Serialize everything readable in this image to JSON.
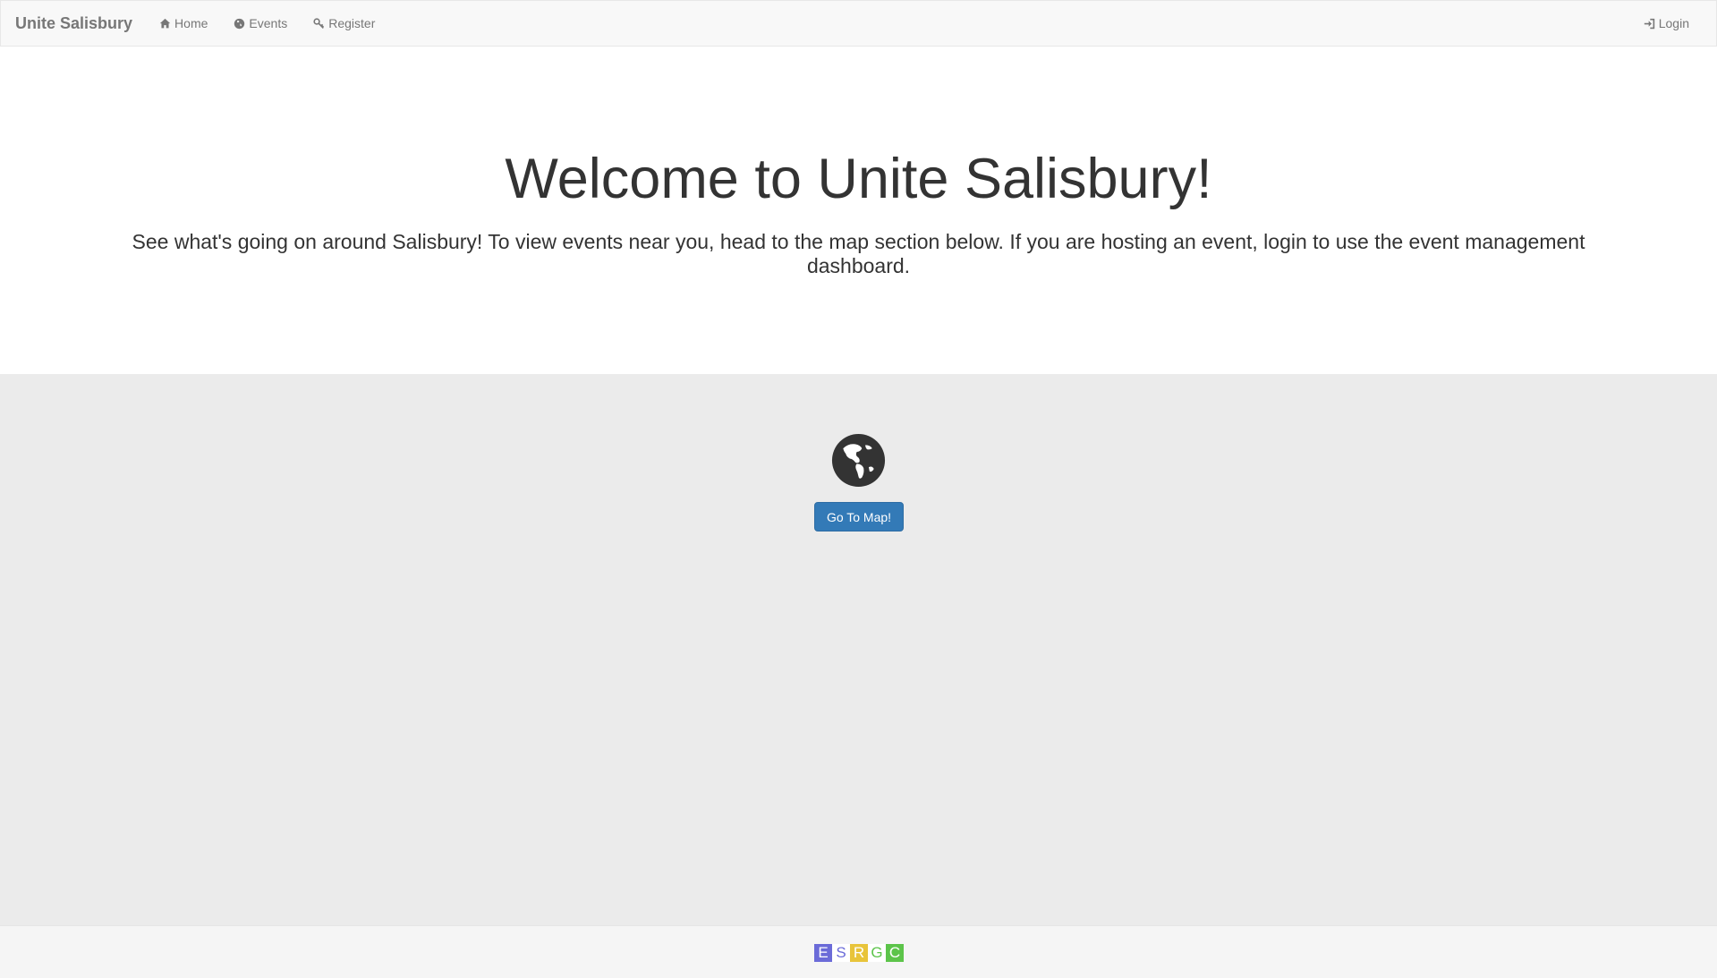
{
  "navbar": {
    "brand": "Unite Salisbury",
    "links": [
      {
        "label": "Home",
        "icon": "home-icon"
      },
      {
        "label": "Events",
        "icon": "globe-icon"
      },
      {
        "label": "Register",
        "icon": "key-icon"
      }
    ],
    "login": {
      "label": "Login",
      "icon": "login-icon"
    }
  },
  "hero": {
    "title": "Welcome to Unite Salisbury!",
    "subtitle": "See what's going on around Salisbury! To view events near you, head to the map section below. If you are hosting an event, login to use the event management dashboard."
  },
  "map_section": {
    "icon": "globe-icon",
    "button_label": "Go To Map!"
  },
  "footer": {
    "logo_letters": [
      {
        "letter": "E",
        "bg": "#6b6bd8",
        "fg": "#ffffff"
      },
      {
        "letter": "S",
        "bg": "#ffffff",
        "fg": "#6b6bd8"
      },
      {
        "letter": "R",
        "bg": "#e8c43a",
        "fg": "#ffffff"
      },
      {
        "letter": "G",
        "bg": "#ffffff",
        "fg": "#5cc44a"
      },
      {
        "letter": "C",
        "bg": "#5cc44a",
        "fg": "#ffffff"
      }
    ]
  },
  "colors": {
    "primary_button": "#337ab7",
    "navbar_bg": "#f8f8f8",
    "map_section_bg": "#ebebeb"
  }
}
